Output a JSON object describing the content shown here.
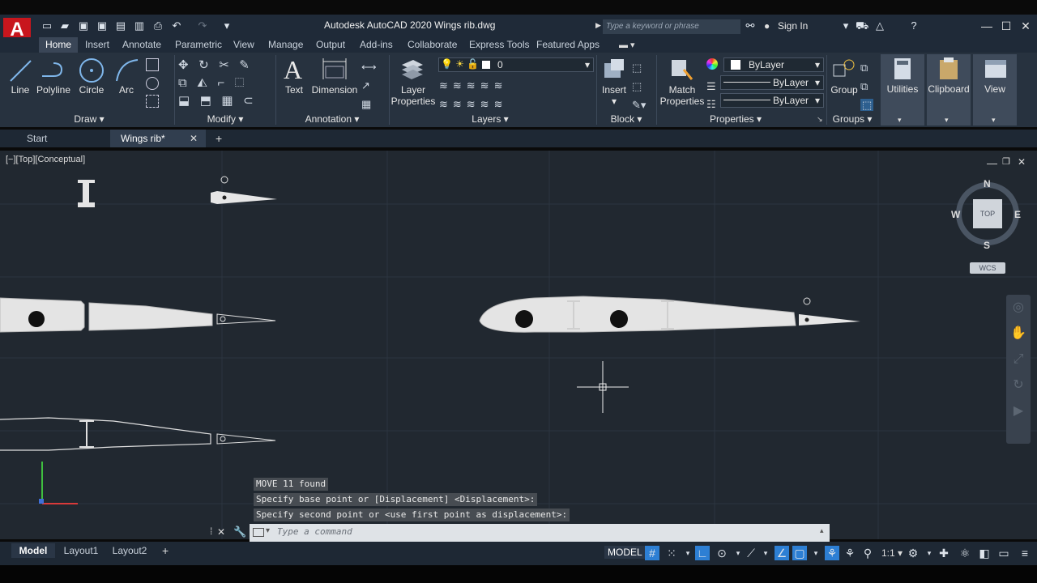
{
  "app": {
    "logo_letter": "A",
    "title": "Autodesk AutoCAD 2020   Wings rib.dwg",
    "search_placeholder": "Type a keyword or phrase",
    "sign_in": "Sign In"
  },
  "ribbon_tabs": [
    "Home",
    "Insert",
    "Annotate",
    "Parametric",
    "View",
    "Manage",
    "Output",
    "Add-ins",
    "Collaborate",
    "Express Tools",
    "Featured Apps"
  ],
  "active_ribbon_tab": "Home",
  "draw_panel": {
    "title": "Draw",
    "tools": [
      "Line",
      "Polyline",
      "Circle",
      "Arc"
    ]
  },
  "modify_panel": {
    "title": "Modify"
  },
  "annotation_panel": {
    "title": "Annotation",
    "tools": [
      "Text",
      "Dimension"
    ]
  },
  "layers_panel": {
    "title": "Layers",
    "layer_properties_line1": "Layer",
    "layer_properties_line2": "Properties",
    "current_layer": "0"
  },
  "block_panel": {
    "title": "Block",
    "insert": "Insert"
  },
  "properties_panel": {
    "title": "Properties",
    "match_line1": "Match",
    "match_line2": "Properties",
    "color": "ByLayer",
    "linetype": "ByLayer",
    "lineweight": "ByLayer"
  },
  "groups_panel": {
    "title": "Groups",
    "group": "Group"
  },
  "utilities": "Utilities",
  "clipboard": "Clipboard",
  "view": "View",
  "doc_tabs": {
    "start": "Start",
    "file": "Wings rib*"
  },
  "viewport_label": "[−][Top][Conceptual]",
  "viewcube": {
    "n": "N",
    "s": "S",
    "e": "E",
    "w": "W",
    "face": "TOP",
    "wcs": "WCS"
  },
  "command_history": [
    "MOVE 11 found",
    "Specify base point or [Displacement] <Displacement>:",
    "Specify second point or <use first point as displacement>:"
  ],
  "command_placeholder": "Type a command",
  "layout_tabs": [
    "Model",
    "Layout1",
    "Layout2"
  ],
  "status": {
    "model": "MODEL",
    "scale": "1:1"
  },
  "colors": {
    "canvas": "#212830",
    "ribbon": "#27323f",
    "accent": "#2d7fd4",
    "logo": "#c8161d"
  }
}
